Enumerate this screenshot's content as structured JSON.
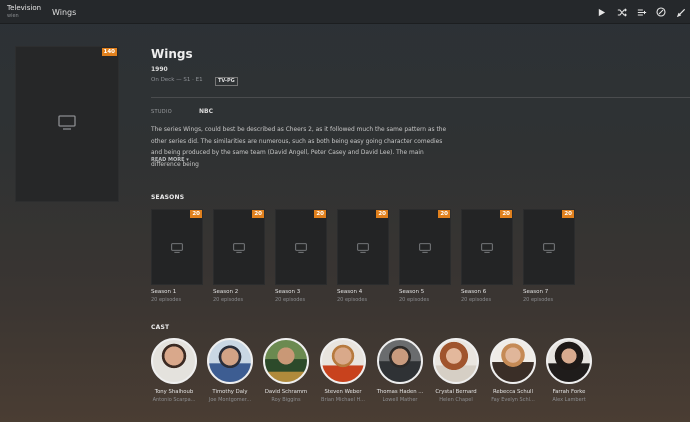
{
  "topbar": {
    "library_title": "Television",
    "library_subtitle": "wien",
    "page_title": "Wings",
    "icons": [
      "play-icon",
      "shuffle-icon",
      "add-to-playlist-icon",
      "mark-watched-icon",
      "edit-icon"
    ]
  },
  "show": {
    "poster_badge": "140",
    "title": "Wings",
    "year": "1990",
    "on_deck": "On Deck  — S1 · E1",
    "content_rating": "TV-PG",
    "studio_label": "STUDIO",
    "studio": "NBC",
    "summary": "The series Wings, could best be described as Cheers 2, as it followed much the same pattern as the other series did. The similarities are numerous, such as both being easy going character comedies and being produced by the same team (David Angell, Peter Casey and David Lee). The main difference being",
    "read_more": "READ MORE ▾"
  },
  "seasons": {
    "heading": "SEASONS",
    "items": [
      {
        "name": "Season 1",
        "episodes": "20 episodes",
        "badge": "20"
      },
      {
        "name": "Season 2",
        "episodes": "20 episodes",
        "badge": "20"
      },
      {
        "name": "Season 3",
        "episodes": "20 episodes",
        "badge": "20"
      },
      {
        "name": "Season 4",
        "episodes": "20 episodes",
        "badge": "20"
      },
      {
        "name": "Season 5",
        "episodes": "20 episodes",
        "badge": "20"
      },
      {
        "name": "Season 6",
        "episodes": "20 episodes",
        "badge": "20"
      },
      {
        "name": "Season 7",
        "episodes": "20 episodes",
        "badge": "20"
      }
    ]
  },
  "cast": {
    "heading": "CAST",
    "items": [
      {
        "actor": "Tony Shalhoub",
        "role": "Antonio Scarpa..."
      },
      {
        "actor": "Timothy Daly",
        "role": "Joe Montgomer..."
      },
      {
        "actor": "David Schramm",
        "role": "Roy Biggins"
      },
      {
        "actor": "Steven Weber",
        "role": "Brian Michael H..."
      },
      {
        "actor": "Thomas Haden ...",
        "role": "Lowell Mather"
      },
      {
        "actor": "Crystal Bernard",
        "role": "Helen Chapel"
      },
      {
        "actor": "Rebecca Schull",
        "role": "Fay Evelyn Schl..."
      },
      {
        "actor": "Farrah Forke",
        "role": "Alex Lambert"
      }
    ]
  },
  "colors": {
    "accent": "#e0801d",
    "background_top": "#2c3136",
    "background_bottom": "#4a3d33"
  }
}
